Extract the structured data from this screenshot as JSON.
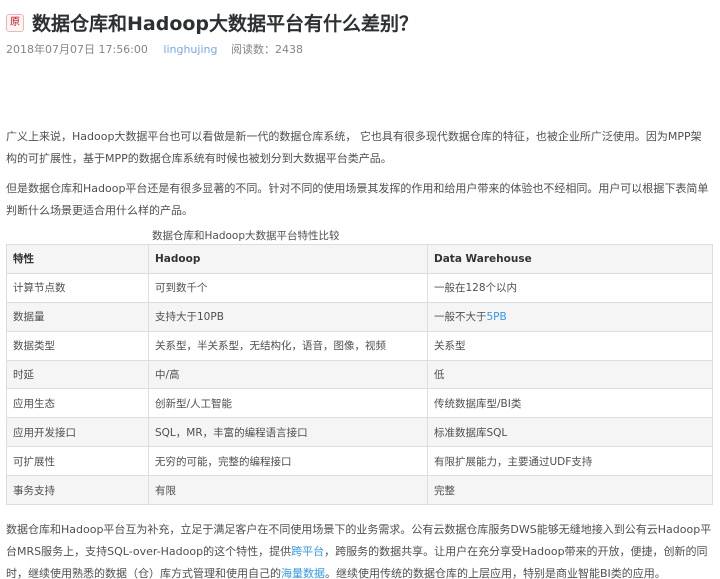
{
  "article": {
    "badge": "原",
    "title": "数据仓库和Hadoop大数据平台有什么差别？",
    "date": "2018年07月07日 17:56:00",
    "author": "linghujing",
    "reads": "阅读数：2438"
  },
  "paragraphs": {
    "p1": "广义上来说，Hadoop大数据平台也可以看做是新一代的数据仓库系统， 它也具有很多现代数据仓库的特征，也被企业所广泛使用。因为MPP架构的可扩展性，基于MPP的数据仓库系统有时候也被划分到大数据平台类产品。",
    "p2": "但是数据仓库和Hadoop平台还是有很多显著的不同。针对不同的使用场景其发挥的作用和给用户带来的体验也不经相同。用户可以根据下表简单判断什么场景更适合用什么样的产品。",
    "p3_a": "数据仓库和Hadoop平台互为补充，立足于满足客户在不同使用场景下的业务需求。公有云数据仓库服务DWS能够无缝地接入到公有云Hadoop平台MRS服务上，支持SQL-over-Hadoop的这个特性，提供",
    "p3_link1": "跨平台",
    "p3_b": "，跨服务的数据共享。让用户在充分享受Hadoop带来的开放，便捷，创新的同时，继续使用熟悉的数据（仓）库方式管理和使用自己的",
    "p3_link2": "海量数据",
    "p3_c": "。继续使用传统的数据仓库的上层应用，特别是商业智能BI类的应用。"
  },
  "table": {
    "caption": "数据仓库和Hadoop大数据平台特性比较",
    "headers": [
      "特性",
      "Hadoop",
      "Data Warehouse"
    ],
    "rows": [
      {
        "feature": "计算节点数",
        "hadoop": "可到数千个",
        "dw": "一般在128个以内"
      },
      {
        "feature": "数据量",
        "hadoop": "支持大于10PB",
        "dw_a": "一般不大于",
        "dw_link": "5PB"
      },
      {
        "feature": "数据类型",
        "hadoop": "关系型，半关系型，无结构化，语音，图像，视频",
        "dw": "关系型"
      },
      {
        "feature": "时延",
        "hadoop": "中/高",
        "dw": "低"
      },
      {
        "feature": "应用生态",
        "hadoop": "创新型/人工智能",
        "dw": "传统数据库型/BI类"
      },
      {
        "feature": "应用开发接口",
        "hadoop": "SQL，MR，丰富的编程语言接口",
        "dw": "标准数据库SQL"
      },
      {
        "feature": "可扩展性",
        "hadoop": "无穷的可能，完整的编程接口",
        "dw": "有限扩展能力，主要通过UDF支持"
      },
      {
        "feature": "事务支持",
        "hadoop": "有限",
        "dw": "完整"
      }
    ]
  },
  "colors": {
    "title": "#2c3033",
    "author_link": "#78a5f1",
    "text_link": "#3399ea",
    "badge_red": "#ca0c16"
  }
}
